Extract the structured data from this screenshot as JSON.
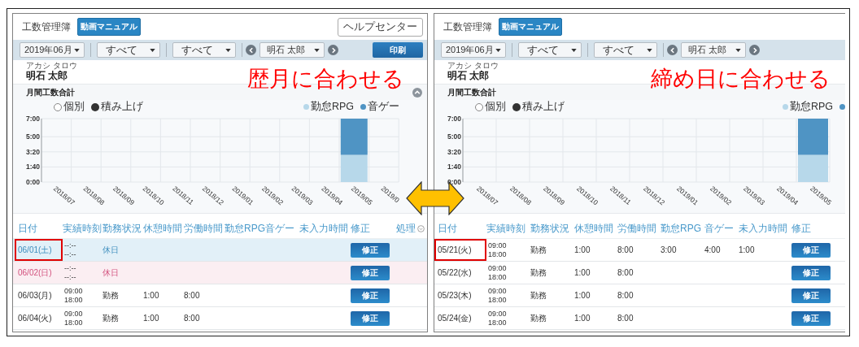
{
  "panels": [
    {
      "title": "工数管理簿",
      "manual_button": "動画マニュアル",
      "help_button": "ヘルプセンター",
      "filters": [
        "2019年06月",
        "すべて",
        "すべて"
      ],
      "person_select": "明石 太郎",
      "print_button": "印刷",
      "name_kana": "アカシ タロウ",
      "name": "明石 太郎",
      "annotation": "歴月に合わせる",
      "section_title": "月間工数合計",
      "expanded": true,
      "chart_modes": [
        {
          "label": "個別",
          "selected": false
        },
        {
          "label": "積み上げ",
          "selected": true
        }
      ],
      "chart_data": {
        "type": "bar",
        "stacked": true,
        "grid": true,
        "categories": [
          "2018/07",
          "2018/08",
          "2018/09",
          "2018/10",
          "2018/11",
          "2018/12",
          "2019/01",
          "2019/02",
          "2019/03",
          "2019/04",
          "2019/05",
          "2019/0"
        ],
        "ylim": [
          0,
          7
        ],
        "yticks": [
          {
            "value": 0,
            "label": "0:00"
          },
          {
            "value": 1.6667,
            "label": "1:40"
          },
          {
            "value": 3.3333,
            "label": "3:20"
          },
          {
            "value": 5,
            "label": "5:00"
          },
          {
            "value": 7,
            "label": "7:00"
          }
        ],
        "series": [
          {
            "name": "勤怠RPG",
            "color": "#b7d8ea",
            "values": [
              null,
              null,
              null,
              null,
              null,
              null,
              null,
              null,
              null,
              null,
              3,
              null
            ]
          },
          {
            "name": "音ゲー",
            "color": "#4f94c4",
            "values": [
              null,
              null,
              null,
              null,
              null,
              null,
              null,
              null,
              null,
              null,
              4,
              null
            ]
          }
        ]
      },
      "columns": [
        {
          "label": "日付"
        },
        {
          "label": "実績時刻"
        },
        {
          "label": "勤務状況"
        },
        {
          "label": "休憩時間"
        },
        {
          "label": "労働時間"
        },
        {
          "label": "勤怠RPG"
        },
        {
          "label": "音ゲー"
        },
        {
          "label": "未入力時間"
        },
        {
          "label": "修正"
        },
        {
          "label": "処理",
          "menu": true
        }
      ],
      "rows": [
        {
          "kind": "saturday",
          "boxed": true,
          "date": "06/01(土)",
          "start": "--:--",
          "end": "--:--",
          "status": "休日",
          "edit": "修正"
        },
        {
          "kind": "sunday",
          "boxed": false,
          "date": "06/02(日)",
          "start": "--:--",
          "end": "--:--",
          "status": "休日",
          "edit": "修正"
        },
        {
          "kind": "weekday",
          "boxed": false,
          "date": "06/03(月)",
          "start": "09:00",
          "end": "18:00",
          "status": "勤務",
          "break": "1:00",
          "work": "8:00",
          "edit": "修正"
        },
        {
          "kind": "weekday",
          "boxed": false,
          "date": "06/04(火)",
          "start": "09:00",
          "end": "18:00",
          "status": "勤務",
          "break": "1:00",
          "work": "8:00",
          "edit": "修正"
        }
      ]
    },
    {
      "title": "工数管理簿",
      "manual_button": "動画マニュアル",
      "filters": [
        "2019年06月",
        "すべて",
        "すべて"
      ],
      "person_select": "明石 太郎",
      "name_kana": "アカシ タロウ",
      "name": "明石 太郎",
      "annotation": "締め日に合わせる",
      "section_title": "月間工数合計",
      "chart_modes": [
        {
          "label": "個別",
          "selected": false
        },
        {
          "label": "積み上げ",
          "selected": true
        }
      ],
      "chart_data": {
        "type": "bar",
        "stacked": true,
        "grid": true,
        "categories": [
          "2018/07",
          "2018/08",
          "2018/09",
          "2018/10",
          "2018/11",
          "2018/12",
          "2019/01",
          "2019/02",
          "2019/03",
          "2019/04",
          "2019/05"
        ],
        "ylim": [
          0,
          7
        ],
        "yticks": [
          {
            "value": 0,
            "label": "0:00"
          },
          {
            "value": 1.6667,
            "label": "1:40"
          },
          {
            "value": 3.3333,
            "label": "3:20"
          },
          {
            "value": 5,
            "label": "5:00"
          },
          {
            "value": 7,
            "label": "7:00"
          }
        ],
        "series": [
          {
            "name": "勤怠RPG",
            "color": "#b7d8ea",
            "values": [
              null,
              null,
              null,
              null,
              null,
              null,
              null,
              null,
              null,
              null,
              3
            ]
          },
          {
            "color": "#4f94c4",
            "values": [
              null,
              null,
              null,
              null,
              null,
              null,
              null,
              null,
              null,
              null,
              4
            ]
          }
        ]
      },
      "columns": [
        {
          "label": "日付"
        },
        {
          "label": "実績時刻"
        },
        {
          "label": "勤務状況"
        },
        {
          "label": "休憩時間"
        },
        {
          "label": "労働時間"
        },
        {
          "label": "勤怠RPG"
        },
        {
          "label": "音ゲー"
        },
        {
          "label": "未入力時間"
        },
        {
          "label": "修正"
        }
      ],
      "rows": [
        {
          "kind": "weekday",
          "boxed": true,
          "date": "05/21(火)",
          "start": "09:00",
          "end": "18:00",
          "status": "勤務",
          "break": "1:00",
          "work": "8:00",
          "rpg": "3:00",
          "game": "4:00",
          "missing": "1:00",
          "edit": "修正"
        },
        {
          "kind": "weekday",
          "boxed": false,
          "date": "05/22(水)",
          "start": "09:00",
          "end": "18:00",
          "status": "勤務",
          "break": "1:00",
          "work": "8:00",
          "edit": "修正"
        },
        {
          "kind": "weekday",
          "boxed": false,
          "date": "05/23(木)",
          "start": "09:00",
          "end": "18:00",
          "status": "勤務",
          "break": "1:00",
          "work": "8:00",
          "edit": "修正"
        },
        {
          "kind": "weekday",
          "boxed": false,
          "date": "05/24(金)",
          "start": "09:00",
          "end": "18:00",
          "status": "勤務",
          "break": "1:00",
          "work": "8:00",
          "edit": "修正"
        }
      ]
    }
  ]
}
